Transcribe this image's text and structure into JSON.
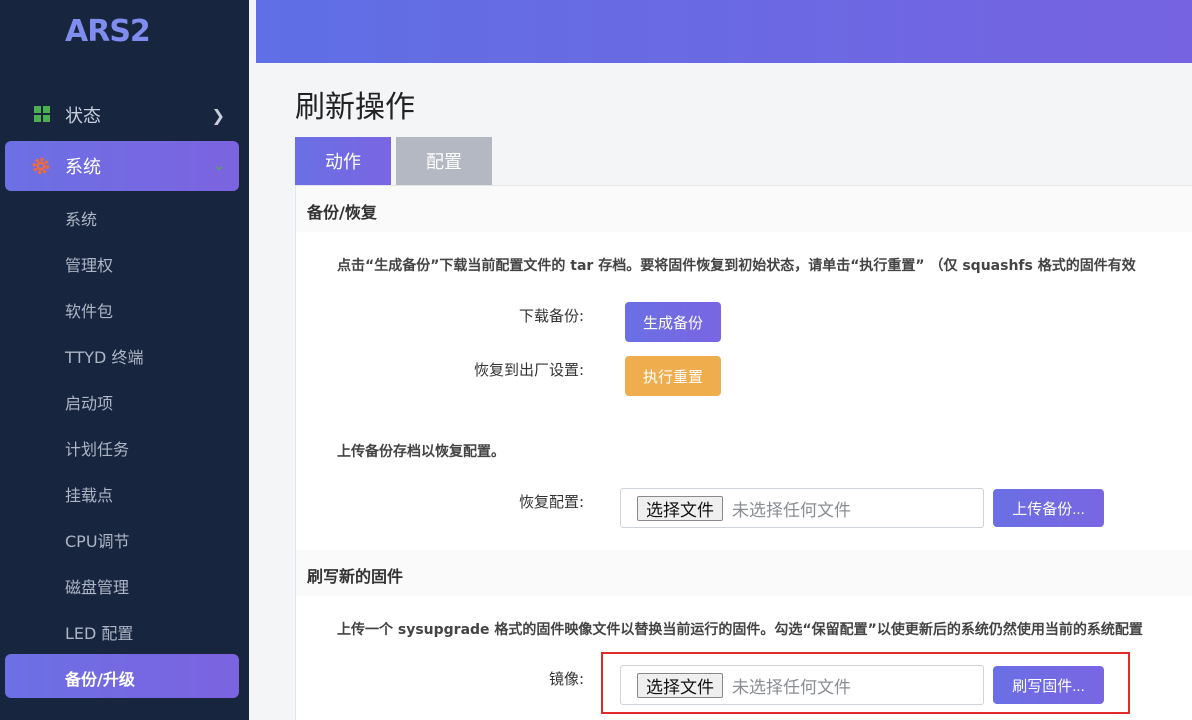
{
  "sidebar": {
    "brand": "ARS2",
    "status_label": "状态",
    "system_label": "系统",
    "sub_items": [
      "系统",
      "管理权",
      "软件包",
      "TTYD 终端",
      "启动项",
      "计划任务",
      "挂载点",
      "CPU调节",
      "磁盘管理",
      "LED 配置"
    ],
    "active_item": "备份/升级"
  },
  "page": {
    "title": "刷新操作",
    "tabs": {
      "action": "动作",
      "config": "配置"
    }
  },
  "backup": {
    "section_title": "备份/恢复",
    "description": "点击“生成备份”下载当前配置文件的 tar 存档。要将固件恢复到初始状态，请单击“执行重置” （仅 squashfs 格式的固件有效",
    "download_label": "下载备份:",
    "download_button": "生成备份",
    "reset_label": "恢复到出厂设置:",
    "reset_button": "执行重置",
    "upload_description": "上传备份存档以恢复配置。",
    "restore_label": "恢复配置:",
    "choose_file": "选择文件",
    "no_file": "未选择任何文件",
    "upload_button": "上传备份..."
  },
  "flash": {
    "section_title": "刷写新的固件",
    "description": "上传一个 sysupgrade 格式的固件映像文件以替换当前运行的固件。勾选“保留配置”以使更新后的系统仍然使用当前的系统配置",
    "image_label": "镜像:",
    "choose_file": "选择文件",
    "no_file": "未选择任何文件",
    "flash_button": "刷写固件..."
  },
  "colors": {
    "sidebar_bg": "#17253f",
    "accent": "#6c70e4",
    "orange": "#f0ad4e",
    "highlight": "#e02b2b"
  }
}
